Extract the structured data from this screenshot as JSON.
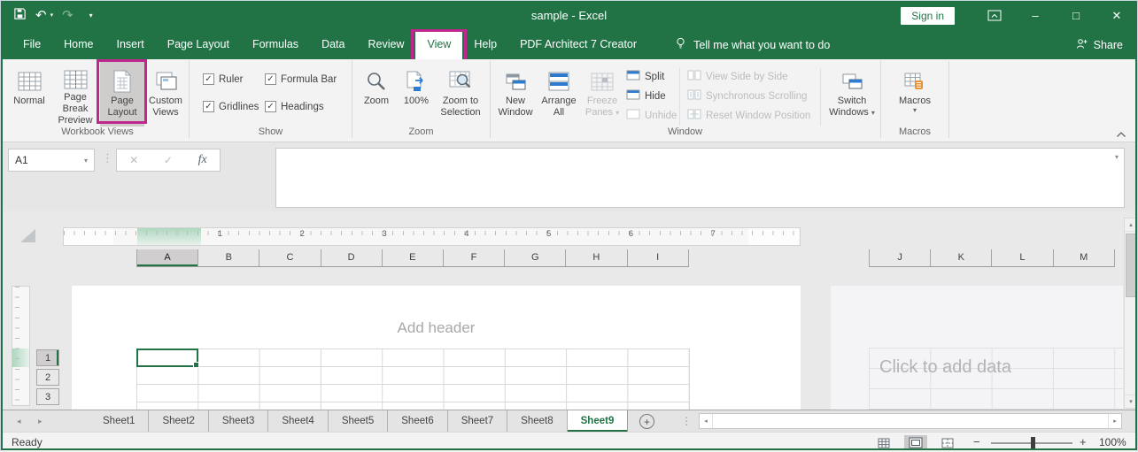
{
  "glyphs": {
    "caret_down": "▾",
    "undo": "↶",
    "redo": "↷",
    "check": "✓",
    "close": "✕",
    "minimize": "–",
    "maximize": "□",
    "dots_v": "⋮",
    "left": "◂",
    "right": "▸",
    "up": "▴",
    "down": "▾",
    "plus": "+",
    "minus": "−",
    "chevron_up": "˄",
    "cancel": "✕",
    "enter": "✓"
  },
  "titlebar": {
    "title": "sample - Excel",
    "sign_in": "Sign in"
  },
  "menu": {
    "tabs": [
      "File",
      "Home",
      "Insert",
      "Page Layout",
      "Formulas",
      "Data",
      "Review",
      "View",
      "Help",
      "PDF Architect 7 Creator"
    ],
    "active_index": 7,
    "tell_me": "Tell me what you want to do",
    "share": "Share"
  },
  "ribbon": {
    "workbook_views": {
      "label": "Workbook Views",
      "normal": "Normal",
      "page_break_preview": "Page Break Preview",
      "page_layout": "Page Layout",
      "custom_views": "Custom Views"
    },
    "show": {
      "label": "Show",
      "ruler": "Ruler",
      "formula_bar": "Formula Bar",
      "gridlines": "Gridlines",
      "headings": "Headings"
    },
    "zoom": {
      "label": "Zoom",
      "zoom": "Zoom",
      "pct": "100%",
      "zoom_to_selection": "Zoom to Selection"
    },
    "window": {
      "label": "Window",
      "new_window": "New Window",
      "arrange_all": "Arrange All",
      "freeze_panes": "Freeze Panes",
      "split": "Split",
      "hide": "Hide",
      "unhide": "Unhide",
      "view_side_by_side": "View Side by Side",
      "synchronous_scrolling": "Synchronous Scrolling",
      "reset_window_position": "Reset Window Position",
      "switch_windows": "Switch Windows"
    },
    "macros": {
      "label": "Macros",
      "macros": "Macros"
    }
  },
  "formula_bar": {
    "name_box": "A1",
    "fx": "fx"
  },
  "worksheet": {
    "ruler_numbers": [
      "1",
      "2",
      "3",
      "4",
      "5",
      "6",
      "7"
    ],
    "columns_left": [
      "A",
      "B",
      "C",
      "D",
      "E",
      "F",
      "G",
      "H",
      "I"
    ],
    "columns_right": [
      "J",
      "K",
      "L",
      "M"
    ],
    "row_numbers": [
      "1",
      "2",
      "3"
    ],
    "selected_column_index": 0,
    "selected_row_index": 0,
    "header_placeholder": "Add header",
    "data_placeholder": "Click to add data"
  },
  "sheet_bar": {
    "tabs": [
      "Sheet1",
      "Sheet2",
      "Sheet3",
      "Sheet4",
      "Sheet5",
      "Sheet6",
      "Sheet7",
      "Sheet8",
      "Sheet9"
    ],
    "active_index": 8
  },
  "status_bar": {
    "ready": "Ready",
    "zoom_level": "100%"
  },
  "colors": {
    "brand_green": "#217346",
    "highlight_magenta": "#c0278c"
  }
}
